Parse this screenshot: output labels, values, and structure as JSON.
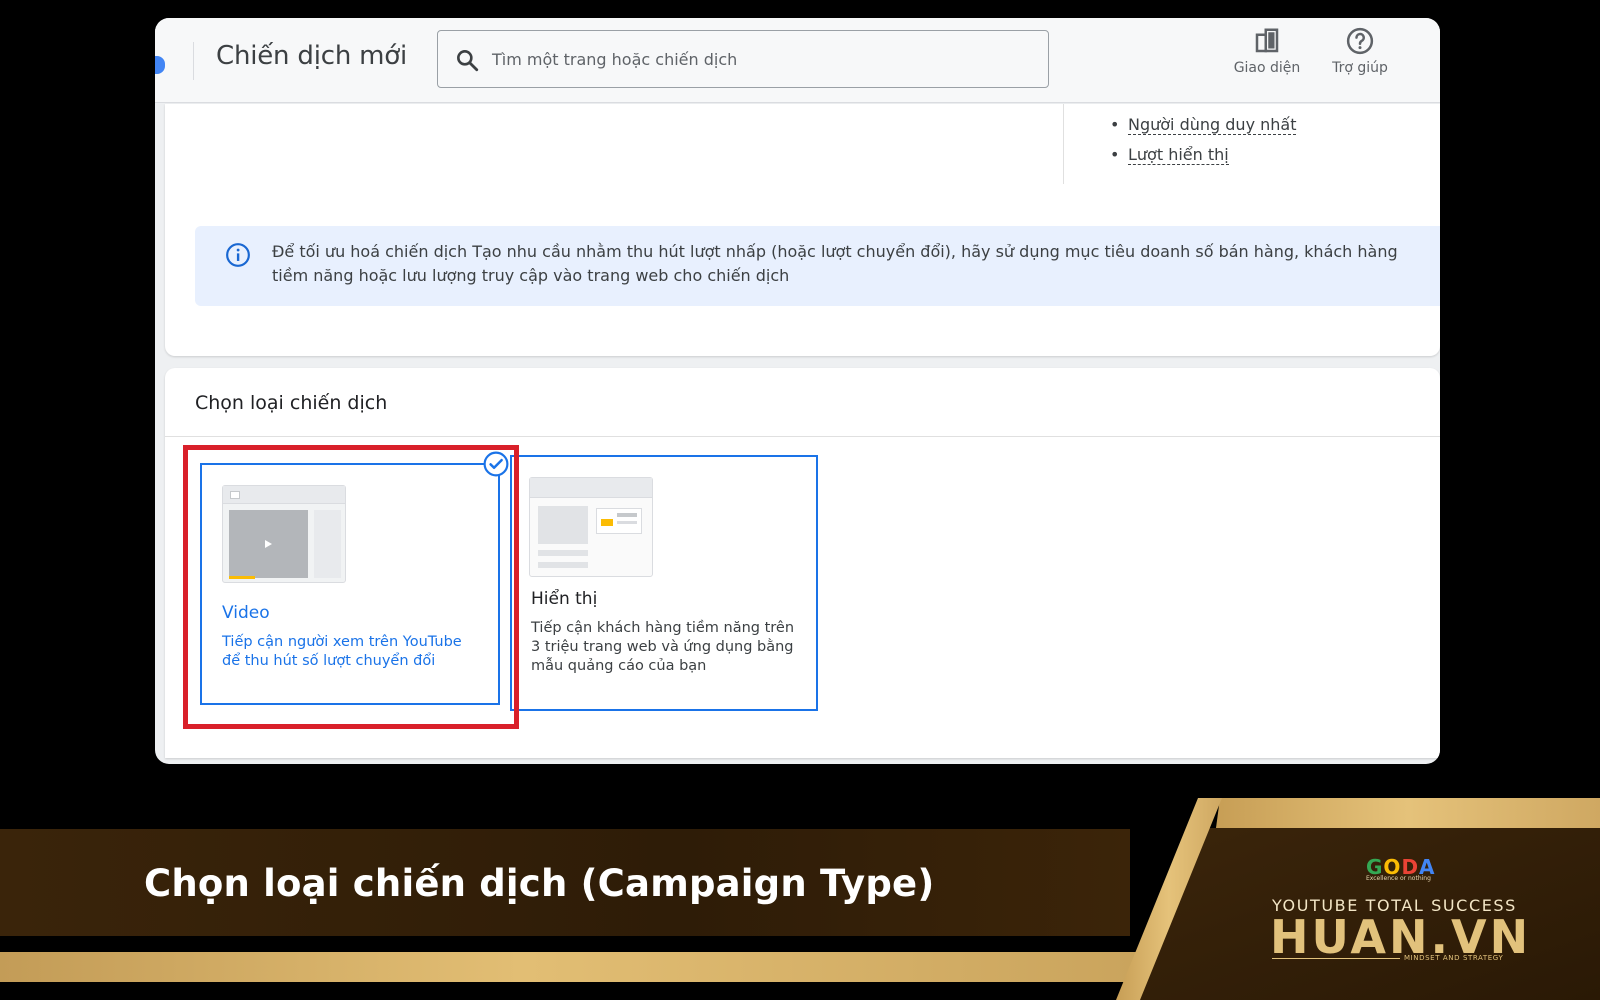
{
  "header": {
    "title": "Chiến dịch mới",
    "search_placeholder": "Tìm một trang hoặc chiến dịch",
    "actions": [
      {
        "label": "Giao diện",
        "icon": "appearance-icon"
      },
      {
        "label": "Trợ giúp",
        "icon": "help-icon"
      }
    ]
  },
  "metrics_list": [
    "Người dùng duy nhất",
    "Lượt hiển thị"
  ],
  "info_banner": {
    "icon": "info-icon",
    "text": "Để tối ưu hoá chiến dịch Tạo nhu cầu nhằm thu hút lượt nhấp (hoặc lượt chuyển đổi), hãy sử dụng mục tiêu doanh số bán hàng, khách hàng tiềm năng hoặc lưu lượng truy cập vào trang web cho chiến dịch"
  },
  "campaign_type": {
    "section_title": "Chọn loại chiến dịch",
    "options": [
      {
        "title": "Video",
        "description": "Tiếp cận người xem trên YouTube để thu hút số lượt chuyển đổi",
        "selected": true
      },
      {
        "title": "Hiển thị",
        "description": "Tiếp cận khách hàng tiềm năng trên 3 triệu trang web và ứng dụng bằng mẫu quảng cáo của bạn",
        "selected": false
      }
    ]
  },
  "banner": {
    "caption": "Chọn loại chiến dịch (Campaign Type)",
    "brand_logo": "GODA",
    "brand_tagline": "Excellence or nothing",
    "brand_line1": "YOUTUBE TOTAL SUCCESS",
    "brand_line2": "HUAN.VN",
    "brand_line3": "MINDSET AND STRATEGY"
  },
  "colors": {
    "accent_blue": "#1a73e8",
    "highlight_red": "#d9202a",
    "banner_gold": "#e2be74",
    "banner_dark": "#3a240a"
  }
}
